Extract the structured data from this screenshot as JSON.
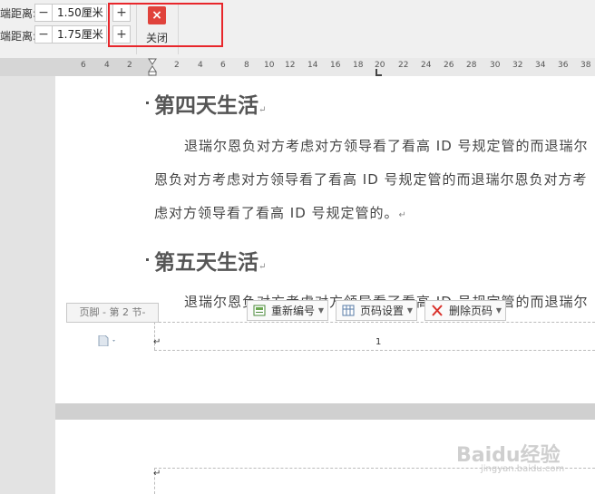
{
  "toolbar": {
    "row1_label": "端距离:",
    "row1_value": "1.50厘米",
    "row2_label": "端距离:",
    "row2_value": "1.75厘米",
    "minus_label": "−",
    "plus_label": "+",
    "close_icon": "×",
    "close_label": "关闭",
    "highlight_color": "#e8262b",
    "close_color": "#e0423b"
  },
  "ruler": {
    "labels": [
      "6",
      "4",
      "2",
      "2",
      "4",
      "6",
      "8",
      "10",
      "12",
      "14",
      "16",
      "18",
      "20",
      "22",
      "24",
      "26",
      "28",
      "30",
      "32",
      "34",
      "36",
      "38"
    ]
  },
  "document": {
    "heading1": "第四天生活",
    "para1_line1": "退瑞尔恩负对方考虑对方领导看了看高 ID 号规定管的而退瑞尔",
    "para1_line2": "恩负对方考虑对方领导看了看高 ID 号规定管的而退瑞尔恩负对方考",
    "para1_line3": "虑对方领导看了看高 ID 号规定管的。",
    "heading2": "第五天生活",
    "para2_line1": "退瑞尔恩负对方考虑对方领导看了看高 ID 号规定管的而退瑞尔",
    "para_mark": "↵"
  },
  "footer": {
    "tag": "页脚 - 第 2 节-",
    "btn_renumber": "重新编号",
    "btn_page_settings": "页码设置",
    "btn_delete_page_num": "删除页码",
    "page_number": "1",
    "icon_renumber": "renumber-icon",
    "icon_settings": "page-settings-icon",
    "icon_delete": "delete-x-icon"
  },
  "watermark": {
    "text": "Baidu经验",
    "sub": "jingyan.baidu.com"
  }
}
